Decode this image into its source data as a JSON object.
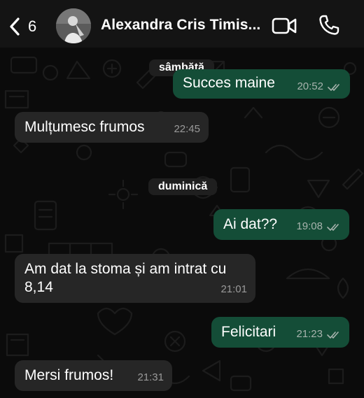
{
  "header": {
    "back_count": "6",
    "contact_name": "Alexandra Cris Timis..."
  },
  "chat": {
    "dates": [
      {
        "label": "sâmbătă"
      },
      {
        "label": "duminică"
      }
    ],
    "messages": [
      {
        "direction": "outgoing",
        "text": "Succes maine",
        "time": "20:52",
        "read": true
      },
      {
        "direction": "incoming",
        "text": "Mulțumesc frumos",
        "time": "22:45"
      },
      {
        "direction": "outgoing",
        "text": "Ai dat??",
        "time": "19:08",
        "read": true
      },
      {
        "direction": "incoming",
        "text": "Am dat la stoma și am intrat cu 8,14",
        "time": "21:01"
      },
      {
        "direction": "outgoing",
        "text": "Felicitari",
        "time": "21:23",
        "read": true
      },
      {
        "direction": "incoming",
        "text": "Mersi frumos!",
        "time": "21:31"
      }
    ]
  },
  "colors": {
    "header_bg": "#141414",
    "chat_bg": "#0b0b0b",
    "incoming_bubble": "#262626",
    "outgoing_bubble": "#144d37",
    "read_ticks": "#a7b3ad"
  },
  "icons": [
    "chevron-left-icon",
    "video-camera-icon",
    "phone-icon",
    "double-check-icon"
  ]
}
